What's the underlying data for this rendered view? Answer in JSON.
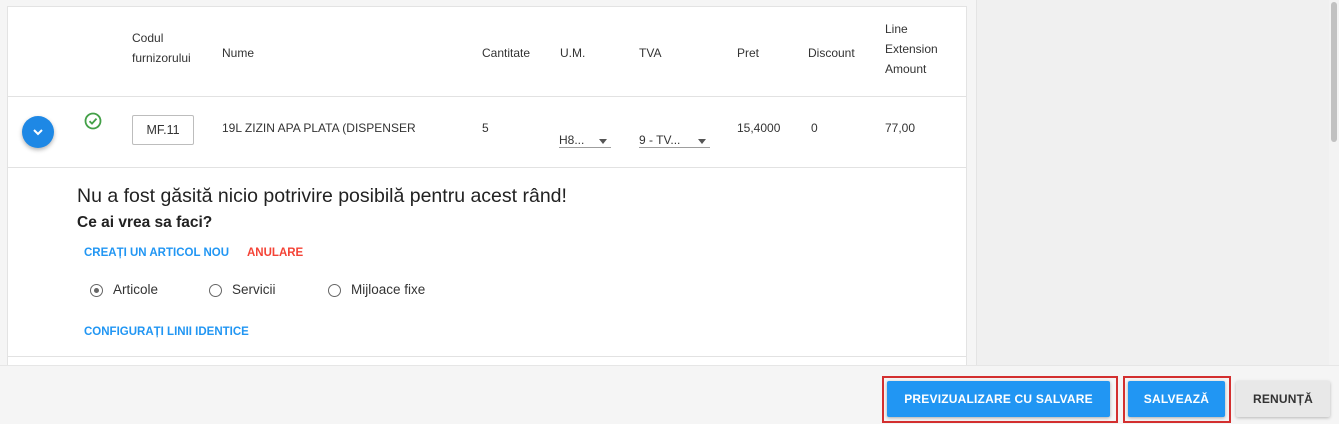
{
  "table": {
    "headers": {
      "code": [
        "Codul",
        "furnizorului"
      ],
      "name": "Nume",
      "quantity": "Cantitate",
      "unit": "U.M.",
      "vat": "TVA",
      "price": "Pret",
      "discount": "Discount",
      "line_amount": [
        "Line",
        "Extension",
        "Amount"
      ]
    },
    "row": {
      "code": "MF.11",
      "name": "19L ZIZIN APA PLATA (DISPENSER",
      "quantity": "5",
      "unit": "H8...",
      "vat": "9 - TV...",
      "price": "15,4000",
      "discount": "0",
      "line_amount": "77,00"
    }
  },
  "detail": {
    "message": "Nu a fost găsită nicio potrivire posibilă pentru acest rând!",
    "question": "Ce ai vrea sa faci?",
    "create_link": "CREAȚI UN ARTICOL NOU",
    "cancel_link": "ANULARE",
    "options": [
      "Articole",
      "Servicii",
      "Mijloace fixe"
    ],
    "selected_option": "Articole",
    "configure_link": "CONFIGURAȚI LINII IDENTICE"
  },
  "footer": {
    "preview_save": "PREVIZUALIZARE CU SALVARE",
    "save": "SALVEAZĂ",
    "cancel": "RENUNȚĂ"
  },
  "colors": {
    "accent": "#2196f3",
    "danger": "#f44336",
    "success": "#43a047",
    "highlight": "#d32f2f"
  }
}
